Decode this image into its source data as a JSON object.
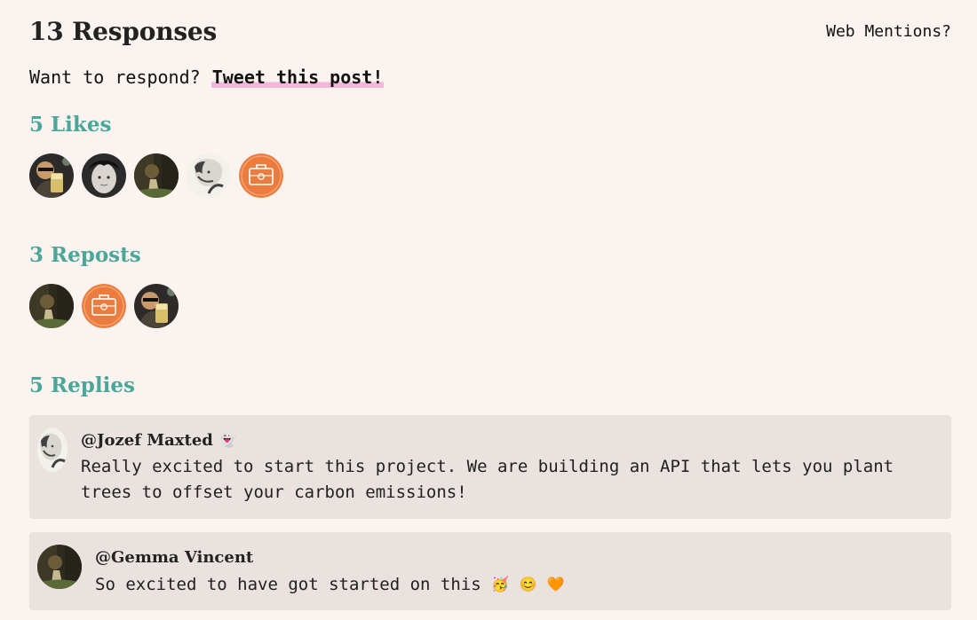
{
  "header": {
    "title": "13 Responses",
    "web_mentions_link": "Web Mentions?"
  },
  "respond": {
    "prompt": "Want to respond?",
    "tweet_link": "Tweet this post!"
  },
  "likes": {
    "title": "5 Likes",
    "avatars": [
      {
        "icon": "person-with-glass-avatar",
        "colors": [
          "#2d2b29",
          "#c99a6a",
          "#d8c06a"
        ]
      },
      {
        "icon": "woman-bw-avatar",
        "colors": [
          "#2b2b2b",
          "#d9d4cf",
          "#f1eeea"
        ]
      },
      {
        "icon": "garden-photo-avatar",
        "colors": [
          "#2f2a1e",
          "#6c5c3a",
          "#c6b98f"
        ]
      },
      {
        "icon": "sketch-portrait-avatar",
        "colors": [
          "#d9d6cf",
          "#404040",
          "#f3f1ec"
        ]
      },
      {
        "icon": "orange-briefcase-avatar",
        "colors": [
          "#ec7c3d",
          "#fff3e8",
          "#f3a06d"
        ]
      }
    ]
  },
  "reposts": {
    "title": "3 Reposts",
    "avatars": [
      {
        "icon": "garden-photo-avatar",
        "colors": [
          "#2f2a1e",
          "#6c5c3a",
          "#c6b98f"
        ]
      },
      {
        "icon": "orange-briefcase-avatar",
        "colors": [
          "#ec7c3d",
          "#fff3e8",
          "#f3a06d"
        ]
      },
      {
        "icon": "person-with-glass-avatar",
        "colors": [
          "#2d2b29",
          "#c99a6a",
          "#d8c06a"
        ]
      }
    ]
  },
  "replies": {
    "title": "5 Replies",
    "items": [
      {
        "author": "@Jozef Maxted",
        "author_emoji": "👻",
        "text": "Really excited to start this project. We are building an API that lets you plant trees to offset your carbon emissions!"
      },
      {
        "author": "@Gemma Vincent",
        "text": "So excited to have got started on this",
        "emojis": [
          "🥳",
          "😊",
          "🧡"
        ]
      }
    ]
  },
  "colors": {
    "background": "#fbf3ef",
    "accent": "#4aa79a",
    "highlight": "#f4b6d8",
    "card": "#e9e2df",
    "orange": "#ec7c3d"
  }
}
